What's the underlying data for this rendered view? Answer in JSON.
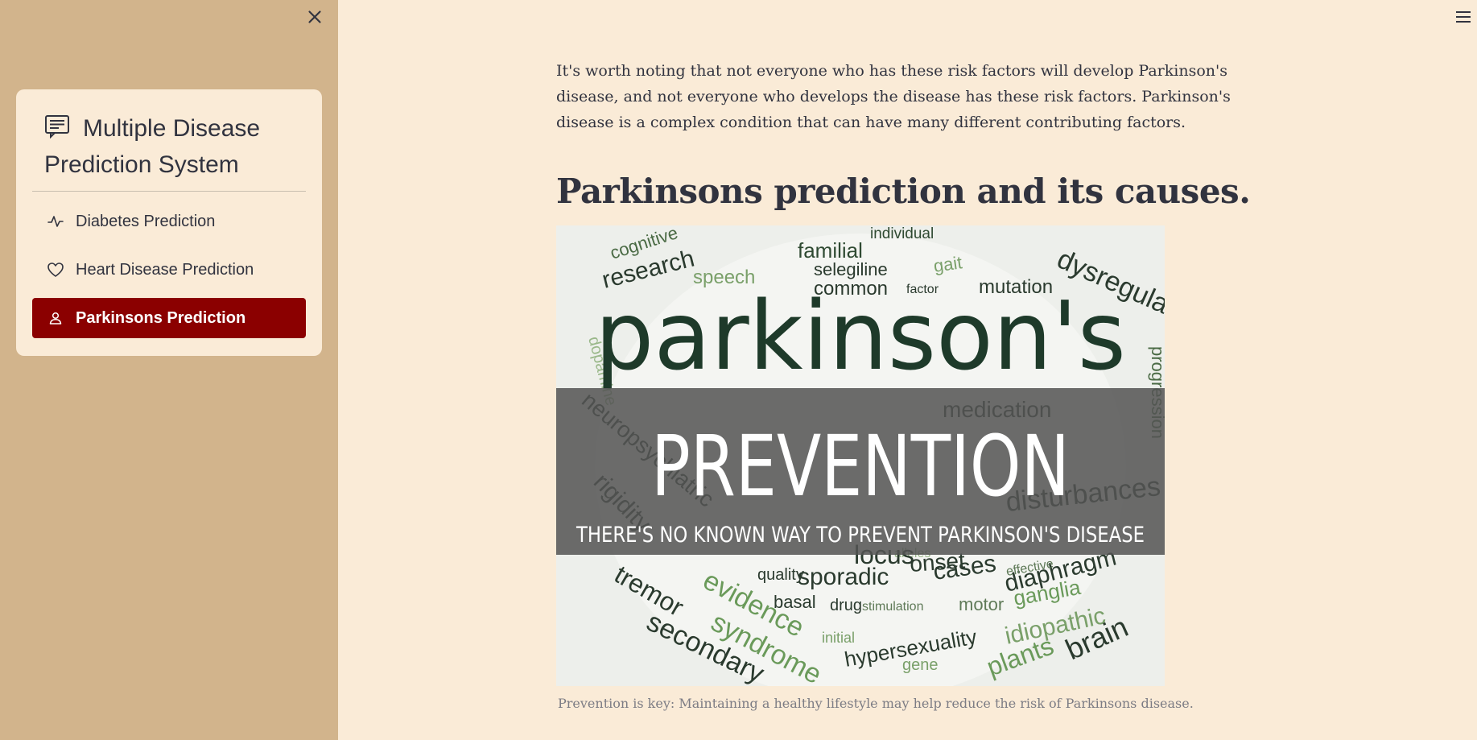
{
  "sidebar": {
    "close_icon": "close-icon",
    "menu": {
      "title": "Multiple Disease Prediction System",
      "title_icon": "chat-text-icon",
      "items": [
        {
          "label": "Diabetes Prediction",
          "icon": "activity-icon",
          "active": false
        },
        {
          "label": "Heart Disease Prediction",
          "icon": "heart-icon",
          "active": false
        },
        {
          "label": "Parkinsons Prediction",
          "icon": "person-icon",
          "active": true
        }
      ]
    }
  },
  "header": {
    "menu_icon": "hamburger-icon"
  },
  "main": {
    "intro_paragraph": "It's worth noting that not everyone who has these risk factors will develop Parkinson's disease, and not everyone who develops the disease has these risk factors. Parkinson's disease is a complex condition that can have many different contributing factors.",
    "heading": "Parkinsons prediction and its causes.",
    "image": {
      "big_word": "parkinson's",
      "banner_title": "PREVENTION",
      "banner_subtitle": "THERE'S NO KNOWN WAY TO PREVENT PARKINSON'S DISEASE",
      "cloud_words": [
        "cognitive",
        "individual",
        "research",
        "familial",
        "dysregulat",
        "speech",
        "selegiline",
        "gait",
        "common",
        "factor",
        "mutation",
        "medication",
        "disturbances",
        "quality",
        "sporadic",
        "cases",
        "diaphragm",
        "basal",
        "drug",
        "stimulation",
        "motor",
        "ganglia",
        "evidence",
        "syndrome",
        "secondary",
        "tremor",
        "initial",
        "hypersexuality",
        "idiopathic",
        "plants",
        "brain",
        "gene",
        "neuropsychiatric",
        "rigidity",
        "dopamine",
        "progression",
        "alleles",
        "effective",
        "locus",
        "onset"
      ],
      "caption": "Prevention is key: Maintaining a healthy lifestyle may help reduce the risk of Parkinsons disease."
    }
  },
  "colors": {
    "sidebar_bg": "#D2B48C",
    "page_bg": "#FAEBD7",
    "active_item": "#8B0000",
    "text": "#31333F"
  }
}
